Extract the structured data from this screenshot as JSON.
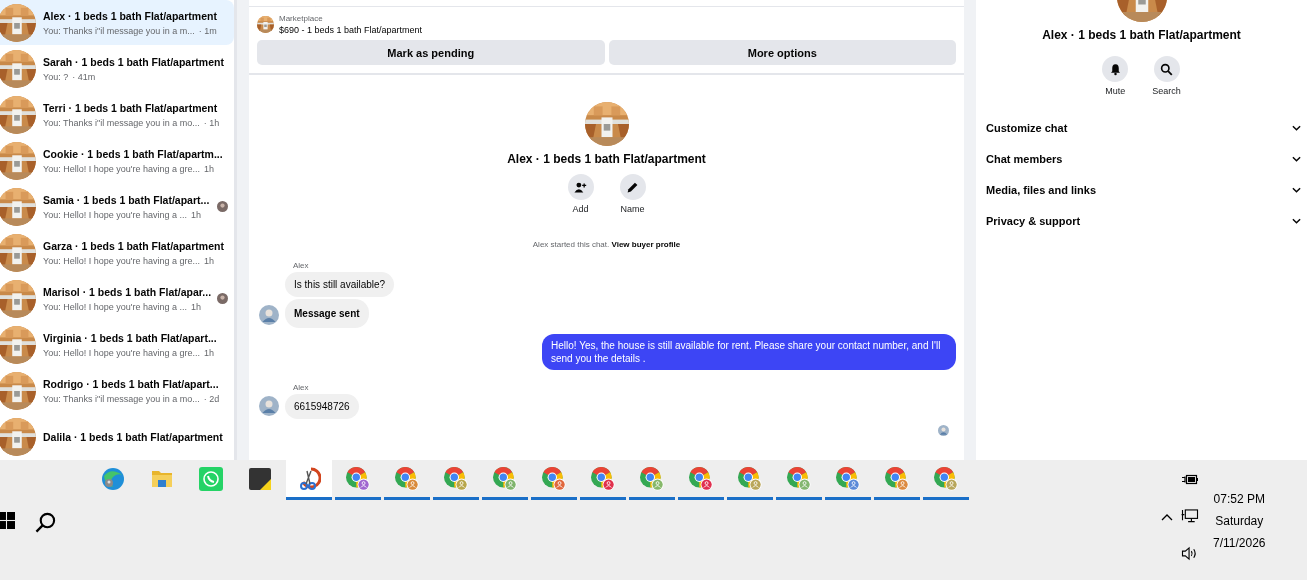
{
  "conversations": [
    {
      "name": "Alex · 1 beds 1 bath Flat/apartment",
      "preview": "You: Thanks i\"il message you in a m...",
      "time": "· 1m",
      "selected": true,
      "seen_avatar": false
    },
    {
      "name": "Sarah · 1 beds 1 bath Flat/apartment",
      "preview": "You: ?",
      "time": "· 41m",
      "selected": false,
      "seen_avatar": false
    },
    {
      "name": "Terri · 1 beds 1 bath Flat/apartment",
      "preview": "You: Thanks i\"il message you in a mo...",
      "time": "· 1h",
      "selected": false,
      "seen_avatar": false
    },
    {
      "name": "Cookie · 1 beds 1 bath Flat/apartm...",
      "preview": "You: Hello! I hope you're having a gre...",
      "time": "1h",
      "selected": false,
      "seen_avatar": false
    },
    {
      "name": "Samia · 1 beds 1 bath Flat/apart...",
      "preview": "You: Hello! I hope you're having a ...",
      "time": "1h",
      "selected": false,
      "seen_avatar": true
    },
    {
      "name": "Garza · 1 beds 1 bath Flat/apartment",
      "preview": "You: Hello! I hope you're having a gre...",
      "time": "1h",
      "selected": false,
      "seen_avatar": false
    },
    {
      "name": "Marisol · 1 beds 1 bath Flat/apar...",
      "preview": "You: Hello! I hope you're having a ...",
      "time": "1h",
      "selected": false,
      "seen_avatar": true
    },
    {
      "name": "Virginia · 1 beds 1 bath Flat/apart...",
      "preview": "You: Hello! I hope you're having a gre...",
      "time": "1h",
      "selected": false,
      "seen_avatar": false
    },
    {
      "name": "Rodrigo · 1 beds 1 bath Flat/apart...",
      "preview": "You: Thanks i\"il message you in a mo...",
      "time": "· 2d",
      "selected": false,
      "seen_avatar": false
    },
    {
      "name": "Dalila · 1 beds 1 bath Flat/apartment",
      "selected": false,
      "seen_avatar": false
    }
  ],
  "listing": {
    "source": "Marketplace",
    "title": "$690 - 1 beds 1 bath Flat/apartment",
    "buttons": [
      "Mark as pending",
      "More options"
    ]
  },
  "chat": {
    "title": "Alex · 1 beds 1 bath Flat/apartment",
    "actions": [
      {
        "kind": "add",
        "label": "Add"
      },
      {
        "kind": "name",
        "label": "Name"
      }
    ],
    "started": "Alex started this chat.",
    "profile_link": "View buyer profile",
    "groups": [
      {
        "kind": "incoming",
        "sender": "Alex",
        "bubbles": [
          {
            "kind": "text",
            "text": "Is this still available?"
          },
          {
            "kind": "notice",
            "text": "Message sent"
          }
        ]
      },
      {
        "kind": "outgoing",
        "bubbles": [
          {
            "kind": "text",
            "text": "Hello! Yes, the house is still available for rent. Please share your contact number, and I'll send you the details ."
          }
        ]
      },
      {
        "kind": "incoming",
        "sender": "Alex",
        "bubbles": [
          {
            "kind": "text",
            "text": "6615948726"
          }
        ]
      }
    ],
    "seen": true
  },
  "details": {
    "title": "Alex · 1 beds 1 bath Flat/apartment",
    "actions": [
      {
        "kind": "mute",
        "label": "Mute"
      },
      {
        "kind": "search",
        "label": "Search"
      }
    ],
    "sections": [
      {
        "label": "Customize chat",
        "expanded": false
      },
      {
        "label": "Chat members",
        "expanded": false
      },
      {
        "label": "Media, files and links",
        "expanded": false
      },
      {
        "label": "Privacy & support",
        "expanded": false
      }
    ]
  },
  "taskbar": {
    "apps": [
      {
        "kind": "edge",
        "running": false,
        "active": false
      },
      {
        "kind": "folder",
        "running": false,
        "active": false
      },
      {
        "kind": "whatsapp",
        "running": false,
        "active": false
      },
      {
        "kind": "sticky",
        "running": false,
        "active": false
      },
      {
        "kind": "snip",
        "running": true,
        "active": true
      },
      {
        "kind": "chrome",
        "running": true,
        "active": false,
        "color": "#a066d0"
      },
      {
        "kind": "chrome",
        "running": true,
        "active": false,
        "color": "#d98a3a"
      },
      {
        "kind": "chrome",
        "running": true,
        "active": false,
        "color": "#b8a64a"
      },
      {
        "kind": "chrome",
        "running": true,
        "active": false,
        "color": "#7fb46c"
      },
      {
        "kind": "chrome",
        "running": true,
        "active": false,
        "color": "#e0683e"
      },
      {
        "kind": "chrome",
        "running": true,
        "active": false,
        "color": "#e0304c"
      },
      {
        "kind": "chrome",
        "running": true,
        "active": false,
        "color": "#86b86a"
      },
      {
        "kind": "chrome",
        "running": true,
        "active": false,
        "color": "#e03050"
      },
      {
        "kind": "chrome",
        "running": true,
        "active": false,
        "color": "#b9a65a"
      },
      {
        "kind": "chrome",
        "running": true,
        "active": false,
        "color": "#84b670"
      },
      {
        "kind": "chrome",
        "running": true,
        "active": false,
        "color": "#5b8ad8"
      },
      {
        "kind": "chrome",
        "running": true,
        "active": false,
        "color": "#dc8a40"
      },
      {
        "kind": "chrome",
        "running": true,
        "active": false,
        "color": "#b8a65c"
      }
    ],
    "time": "07:52 PM",
    "day": "Saturday",
    "date": "7/11/2026"
  }
}
